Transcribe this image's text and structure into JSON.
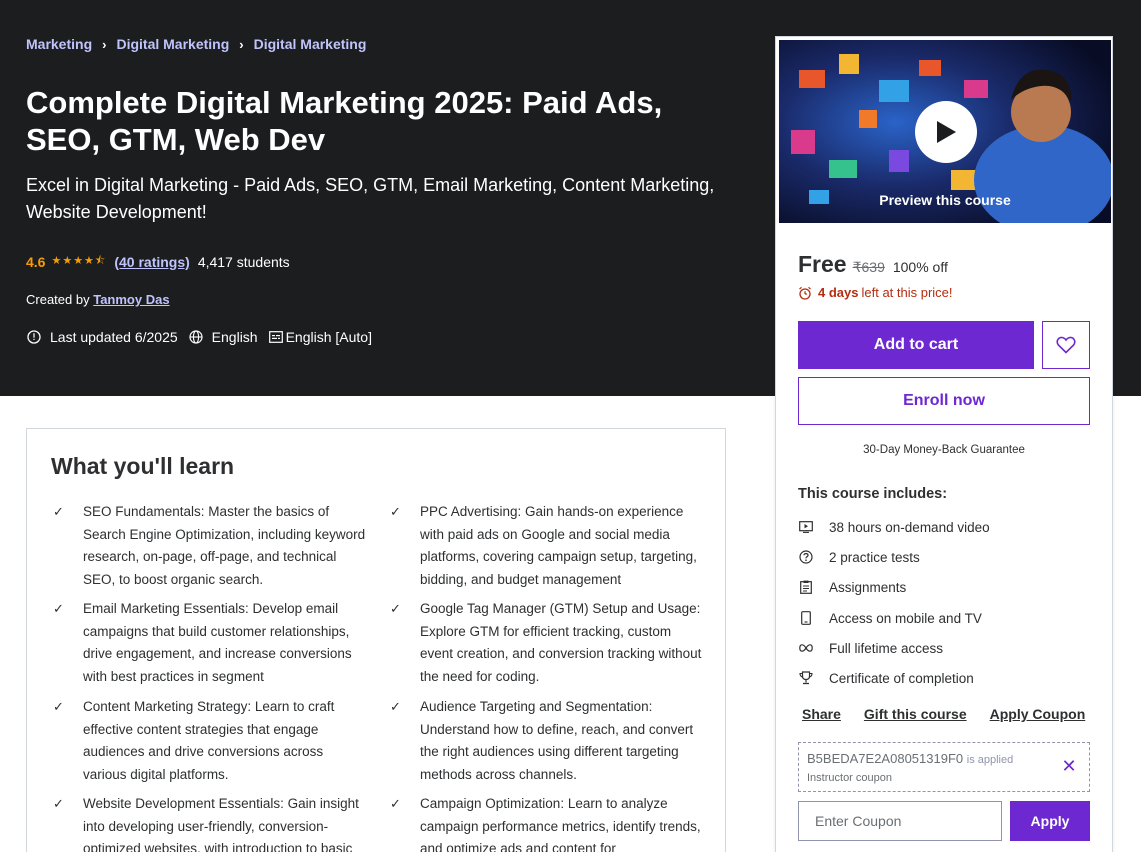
{
  "breadcrumb": [
    "Marketing",
    "Digital Marketing",
    "Digital Marketing"
  ],
  "course": {
    "title": "Complete Digital Marketing 2025: Paid Ads, SEO, GTM, Web Dev",
    "subtitle": "Excel in Digital Marketing - Paid Ads, SEO, GTM, Email Marketing, Content Marketing, Website Development!",
    "rating": "4.6",
    "rating_value": 4.6,
    "ratings_count": "(40 ratings)",
    "students": "4,417 students",
    "created_by_label": "Created by",
    "instructor": "Tanmoy Das",
    "last_updated": "Last updated 6/2025",
    "language": "English",
    "captions": "English [Auto]"
  },
  "learn": {
    "title": "What you'll learn",
    "items": [
      "SEO Fundamentals: Master the basics of Search Engine Optimization, including keyword research, on-page, off-page, and technical SEO, to boost organic search.",
      "PPC Advertising: Gain hands-on experience with paid ads on Google and social media platforms, covering campaign setup, targeting, bidding, and budget management",
      "Email Marketing Essentials: Develop email campaigns that build customer relationships, drive engagement, and increase conversions with best practices in segment",
      "Google Tag Manager (GTM) Setup and Usage: Explore GTM for efficient tracking, custom event creation, and conversion tracking without the need for coding.",
      "Content Marketing Strategy: Learn to craft effective content strategies that engage audiences and drive conversions across various digital platforms.",
      "Audience Targeting and Segmentation: Understand how to define, reach, and convert the right audiences using different targeting methods across channels.",
      "Website Development Essentials: Gain insight into developing user-friendly, conversion-optimized websites, with introduction to basic",
      "Campaign Optimization: Learn to analyze campaign performance metrics, identify trends, and optimize ads and content for"
    ]
  },
  "sidebar": {
    "preview_label": "Preview this course",
    "price_free": "Free",
    "price_original": "₹639",
    "discount": "100% off",
    "timer_days": "4 days",
    "timer_text": "left at this price!",
    "add_to_cart": "Add to cart",
    "enroll_now": "Enroll now",
    "guarantee": "30-Day Money-Back Guarantee",
    "includes_title": "This course includes:",
    "includes": [
      {
        "icon": "video-icon",
        "label": "38 hours on-demand video"
      },
      {
        "icon": "question-icon",
        "label": "2 practice tests"
      },
      {
        "icon": "clipboard-icon",
        "label": "Assignments"
      },
      {
        "icon": "mobile-icon",
        "label": "Access on mobile and TV"
      },
      {
        "icon": "infinity-icon",
        "label": "Full lifetime access"
      },
      {
        "icon": "trophy-icon",
        "label": "Certificate of completion"
      }
    ],
    "share": "Share",
    "gift": "Gift this course",
    "apply_coupon": "Apply Coupon",
    "coupon_code": "B5BEDA7E2A08051319F0",
    "coupon_applied": "is applied",
    "coupon_type": "Instructor coupon",
    "coupon_placeholder": "Enter Coupon",
    "apply_button": "Apply"
  },
  "colors": {
    "accent": "#6d28d2",
    "hero_bg": "#1c1d1f",
    "star": "#f69c08",
    "link_light": "#c0c4fc",
    "alert": "#b32d0f"
  }
}
